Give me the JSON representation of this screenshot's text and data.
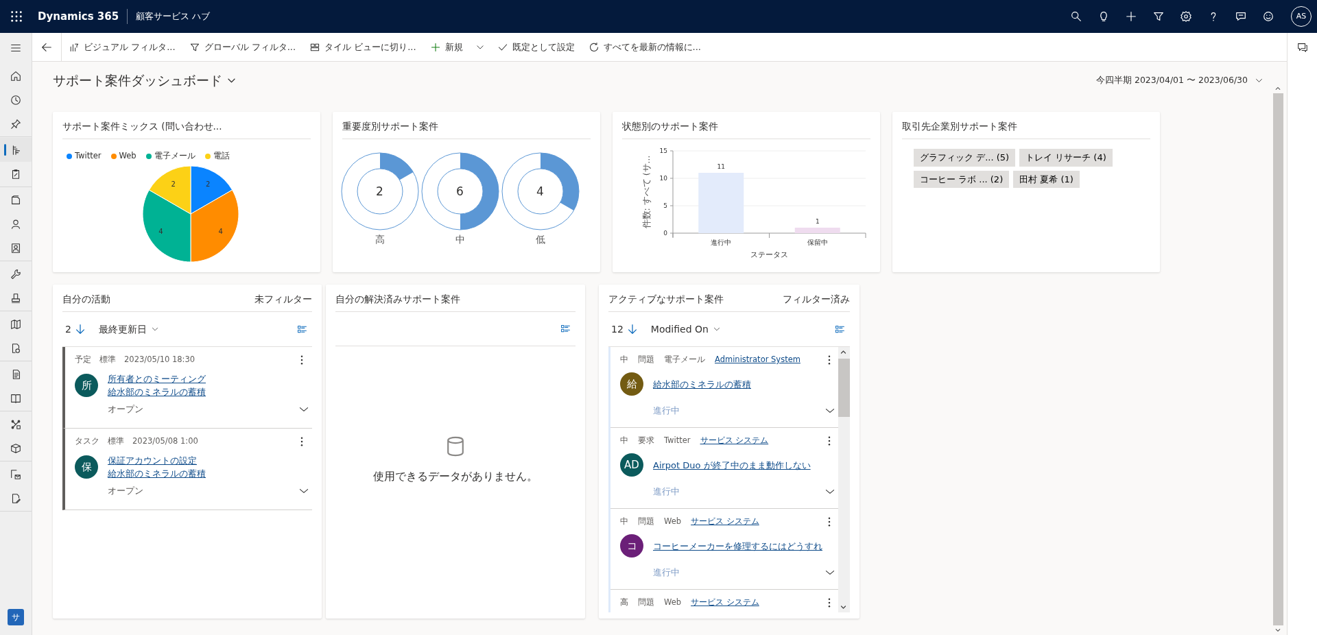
{
  "app_bar": {
    "app_name": "Dynamics 365",
    "area": "顧客サービス ハブ",
    "avatar": "AS"
  },
  "sidebar": {
    "groups": [
      {
        "items": [
          {
            "selected": false
          },
          {
            "selected": false
          },
          {
            "selected": false
          }
        ]
      },
      {
        "items": [
          {
            "selected": true
          },
          {
            "selected": false
          }
        ]
      },
      {
        "items": [
          {
            "selected": false
          },
          {
            "selected": false
          },
          {
            "selected": false
          }
        ]
      },
      {
        "items": [
          {
            "selected": false
          },
          {
            "selected": false
          }
        ]
      },
      {
        "items": [
          {
            "selected": false
          },
          {
            "selected": false
          }
        ]
      },
      {
        "items": [
          {
            "selected": false
          },
          {
            "selected": false
          }
        ]
      },
      {
        "items": [
          {
            "selected": false
          },
          {
            "selected": false
          }
        ]
      },
      {
        "items": [
          {
            "selected": false
          },
          {
            "selected": false
          }
        ]
      }
    ],
    "area_badge": "サ"
  },
  "command_bar": {
    "items": [
      {
        "label": "ビジュアル フィルタ...",
        "kind": "button"
      },
      {
        "label": "グローバル フィルタ...",
        "kind": "button"
      },
      {
        "label": "タイル ビューに切り...",
        "kind": "button"
      },
      {
        "label": "新規",
        "kind": "split"
      },
      {
        "label": "既定として設定",
        "kind": "button"
      },
      {
        "label": "すべてを最新の情報に...",
        "kind": "button"
      }
    ]
  },
  "dashboard": {
    "title": "サポート案件ダッシュボード",
    "period": "今四半期 2023/04/01 〜 2023/06/30"
  },
  "case_mix": {
    "title": "サポート案件ミックス (問い合わせ...",
    "chart_data": {
      "type": "pie",
      "categories": [
        "Twitter",
        "Web",
        "電子メール",
        "電話"
      ],
      "values": [
        2,
        4,
        4,
        2
      ],
      "colors": [
        "#0a84ff",
        "#ff8c00",
        "#00b294",
        "#fcd116"
      ],
      "legend": "top",
      "data_labels": true
    }
  },
  "by_severity": {
    "title": "重要度別サポート案件",
    "tiles": [
      {
        "count": "2",
        "label": "高"
      },
      {
        "count": "6",
        "label": "中"
      },
      {
        "count": "4",
        "label": "低"
      }
    ]
  },
  "by_status": {
    "title": "状態別のサポート案件",
    "chart_data": {
      "type": "bar",
      "categories": [
        "進行中",
        "保留中"
      ],
      "values": [
        11,
        1
      ],
      "colors": [
        "#e3ebfb",
        "#efdcef"
      ],
      "ylim": [
        0,
        15
      ],
      "yticks": [
        0,
        5,
        10,
        15
      ],
      "xlabel": "ステータス",
      "ylabel": "件数: すべて (サ...",
      "data_labels": true
    }
  },
  "by_account": {
    "title": "取引先企業別サポート案件",
    "tags": [
      "グラフィック デ... (5)",
      "トレイ リサーチ (4)",
      "コーヒー ラボ ... (2)",
      "田村 夏希 (1)"
    ]
  },
  "my_activities": {
    "title": "自分の活動",
    "filter_label": "未フィルター",
    "count": "2",
    "sort_label": "最終更新日",
    "items": [
      {
        "type": "予定",
        "priority": "標準",
        "date": "2023/05/10 18:30",
        "initial": "所",
        "color": "#0b5a5c",
        "subject": "所有者とのミーティング",
        "regarding": "給水部のミネラルの蓄積",
        "status": "オープン"
      },
      {
        "type": "タスク",
        "priority": "標準",
        "date": "2023/05/08 1:00",
        "initial": "保",
        "color": "#0b5a5c",
        "subject": "保証アカウントの設定",
        "regarding": "給水部のミネラルの蓄積",
        "status": "オープン"
      }
    ]
  },
  "my_resolved_cases": {
    "title": "自分の解決済みサポート案件",
    "empty_message": "使用できるデータがありません。"
  },
  "active_cases": {
    "title": "アクティブなサポート案件",
    "filter_label": "フィルター済み",
    "count": "12",
    "sort_label": "Modified On",
    "items": [
      {
        "priority": "中",
        "type": "問題",
        "channel": "電子メール",
        "owner": "Administrator System",
        "initial": "給",
        "color": "#735b12",
        "title": "給水部のミネラルの蓄積",
        "status": "進行中"
      },
      {
        "priority": "中",
        "type": "要求",
        "channel": "Twitter",
        "owner": "サービス システム",
        "initial": "AD",
        "color": "#0b5a5c",
        "title": "Airpot Duo が終了中のまま動作しない",
        "status": "進行中"
      },
      {
        "priority": "中",
        "type": "問題",
        "channel": "Web",
        "owner": "サービス システム",
        "initial": "コ",
        "color": "#6b1f78",
        "title": "コーヒーメーカーを修理するにはどうすれ",
        "status": "進行中"
      },
      {
        "priority": "高",
        "type": "問題",
        "channel": "Web",
        "owner": "サービス システム"
      }
    ]
  }
}
